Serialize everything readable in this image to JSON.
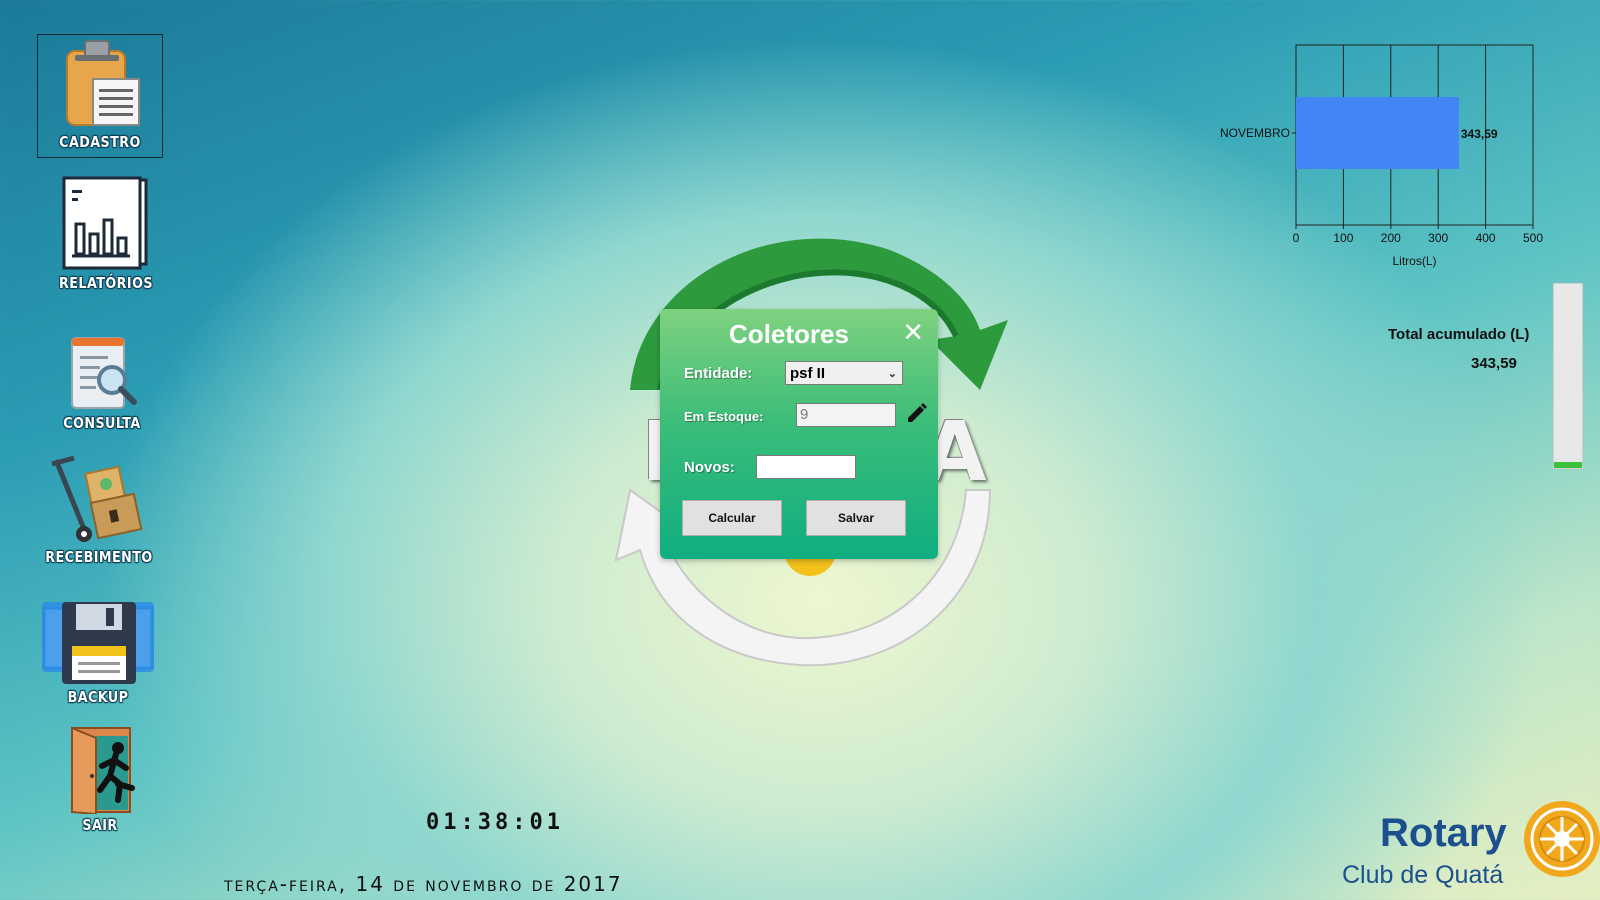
{
  "desktop": {
    "tiles": [
      {
        "label": "CADASTRO",
        "icon": "clipboard-icon"
      },
      {
        "label": "RELATÓRIOS",
        "icon": "report-chart-icon"
      },
      {
        "label": "CONSULTA",
        "icon": "document-search-icon"
      },
      {
        "label": "RECEBIMENTO",
        "icon": "hand-truck-icon"
      },
      {
        "label": "BACKUP",
        "icon": "floppy-disk-icon"
      },
      {
        "label": "SAIR",
        "icon": "exit-door-icon"
      }
    ]
  },
  "logo": {
    "word": "B         TA"
  },
  "dialog": {
    "title": "Coletores",
    "entidade_label": "Entidade:",
    "entidade_value": "psf II",
    "estoque_label": "Em Estoque:",
    "estoque_value": "9",
    "novos_label": "Novos:",
    "novos_value": "",
    "calcular_label": "Calcular",
    "salvar_label": "Salvar"
  },
  "chart_data": {
    "type": "bar",
    "orientation": "horizontal",
    "categories": [
      "NOVEMBRO"
    ],
    "values": [
      343.59
    ],
    "data_labels": [
      "343,59"
    ],
    "xlabel": "Litros(L)",
    "ylabel": "",
    "xlim": [
      0,
      500
    ],
    "xticks": [
      0,
      100,
      200,
      300,
      400,
      500
    ],
    "grid": true,
    "bar_color": "#4285f4"
  },
  "summary": {
    "total_label": "Total acumulado (L)",
    "total_value": "343,59",
    "progress_fraction": 0.03
  },
  "status": {
    "time": "01:38:01",
    "date": "terça-feira, 14 de novembro de 2017"
  },
  "branding": {
    "rotary": "Rotary",
    "club": "Club de Quatá"
  }
}
